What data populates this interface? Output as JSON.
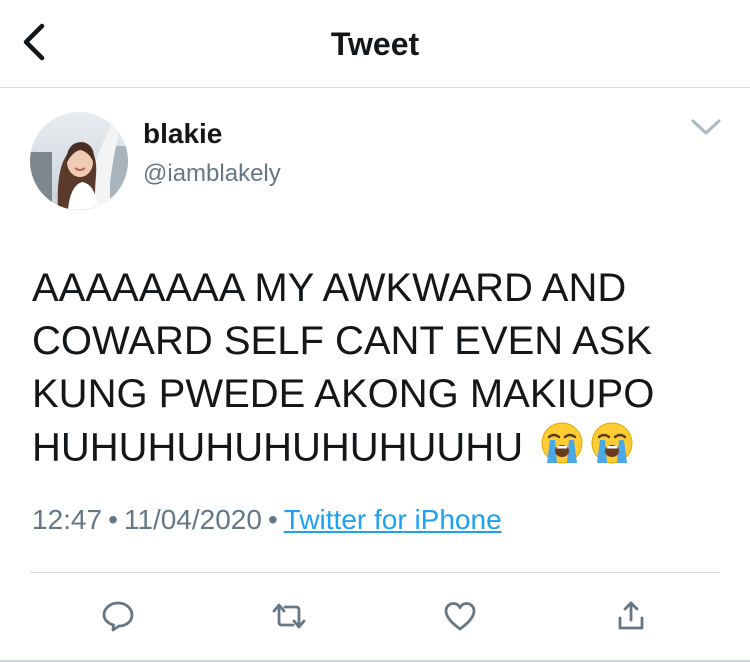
{
  "nav": {
    "title": "Tweet"
  },
  "user": {
    "display_name": "blakie",
    "handle": "@iamblakely"
  },
  "tweet": {
    "lines": [
      "AAAAAAAA MY AWKWARD AND",
      "COWARD SELF CANT EVEN ASK",
      "KUNG PWEDE AKONG MAKIUPO",
      "HUHUHUHUHUHUHUUHU"
    ],
    "emojis": [
      "loudly-crying-face",
      "loudly-crying-face"
    ],
    "time": "12:47",
    "separator": "•",
    "date": "11/04/2020",
    "source": "Twitter for iPhone"
  },
  "icons": {
    "back": "chevron-left-icon",
    "caret": "chevron-down-icon",
    "reply": "reply-icon",
    "retweet": "retweet-icon",
    "like": "heart-icon",
    "share": "share-icon"
  },
  "colors": {
    "text": "#14171a",
    "secondary": "#657786",
    "link": "#1da1f2",
    "divider": "#d7dbdf"
  }
}
